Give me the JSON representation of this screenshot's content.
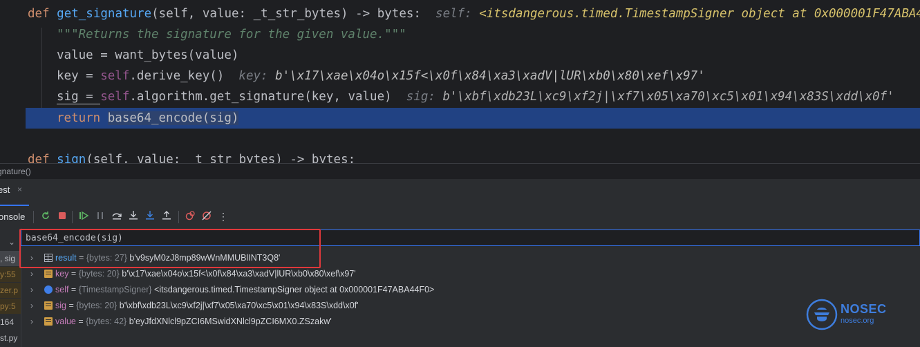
{
  "editor": {
    "def_kw": "def",
    "fn_name": "get_signature",
    "fn_params": "(self, value: _t_str_bytes) -> bytes:",
    "self_hint_label": "self:",
    "self_hint_value": "<itsdangerous.timed.TimestampSigner object at 0x000001F47ABA4",
    "docstring": "\"\"\"Returns the signature for the given value.\"\"\"",
    "line_value": "value = want_bytes(value)",
    "line_key_pre": "key = ",
    "line_key_self": "self",
    "line_key_post": ".derive_key()",
    "key_hint_label": "key:",
    "key_hint_value": "b'\\x17\\xae\\x04o\\x15f<\\x0f\\x84\\xa3\\xadV|lUR\\xb0\\x80\\xef\\x97'",
    "line_sig_pre": "sig = ",
    "line_sig_self": "self",
    "line_sig_post": ".algorithm.get_signature(key, value)",
    "sig_hint_label": "sig:",
    "sig_hint_value": "b'\\xbf\\xdb23L\\xc9\\xf2j|\\xf7\\x05\\xa70\\xc5\\x01\\x94\\x83S\\xdd\\x0f'",
    "return_kw": "return",
    "return_expr": "base64_encode(sig)",
    "next_def_kw": "def",
    "next_fn_name": "sign",
    "next_params": "(self, value: _t_str_bytes) -> bytes:"
  },
  "breadcrumb": "gnature()",
  "debug_tab": {
    "label": "est",
    "close": "×"
  },
  "toolbar": {
    "console_label": "onsole"
  },
  "frames": [
    "",
    ", sig",
    "y:55",
    "zer.p",
    "py:5",
    "164",
    "st.py"
  ],
  "evaluate": {
    "expression": "base64_encode(sig)"
  },
  "variables": [
    {
      "name": "result",
      "type": "{bytes: 27}",
      "value": "b'v9syM0zJ8mp89wWnMMUBlINT3Q8'",
      "icon": "table-icon"
    },
    {
      "name": "key",
      "type": "{bytes: 20}",
      "value": "b'\\x17\\xae\\x04o\\x15f<\\x0f\\x84\\xa3\\xadV|lUR\\xb0\\x80\\xef\\x97'",
      "icon": "list-icon"
    },
    {
      "name": "self",
      "type": "{TimestampSigner}",
      "value": "<itsdangerous.timed.TimestampSigner object at 0x000001F47ABA44F0>",
      "icon": "object-icon"
    },
    {
      "name": "sig",
      "type": "{bytes: 20}",
      "value": "b'\\xbf\\xdb23L\\xc9\\xf2j|\\xf7\\x05\\xa70\\xc5\\x01\\x94\\x83S\\xdd\\x0f'",
      "icon": "list-icon"
    },
    {
      "name": "value",
      "type": "{bytes: 42}",
      "value": "b'eyJfdXNlcl9pZCI6MSwidXNlcl9pZCI6MX0.ZSzakw'",
      "icon": "list-icon"
    }
  ],
  "eq": " = ",
  "watermark": {
    "title": "NOSEC",
    "subtitle": "nosec.org"
  },
  "colors": {
    "accent": "#3574f0",
    "highlight": "#214283",
    "redbox": "#e0383b",
    "watermark": "#3e7ddd"
  }
}
